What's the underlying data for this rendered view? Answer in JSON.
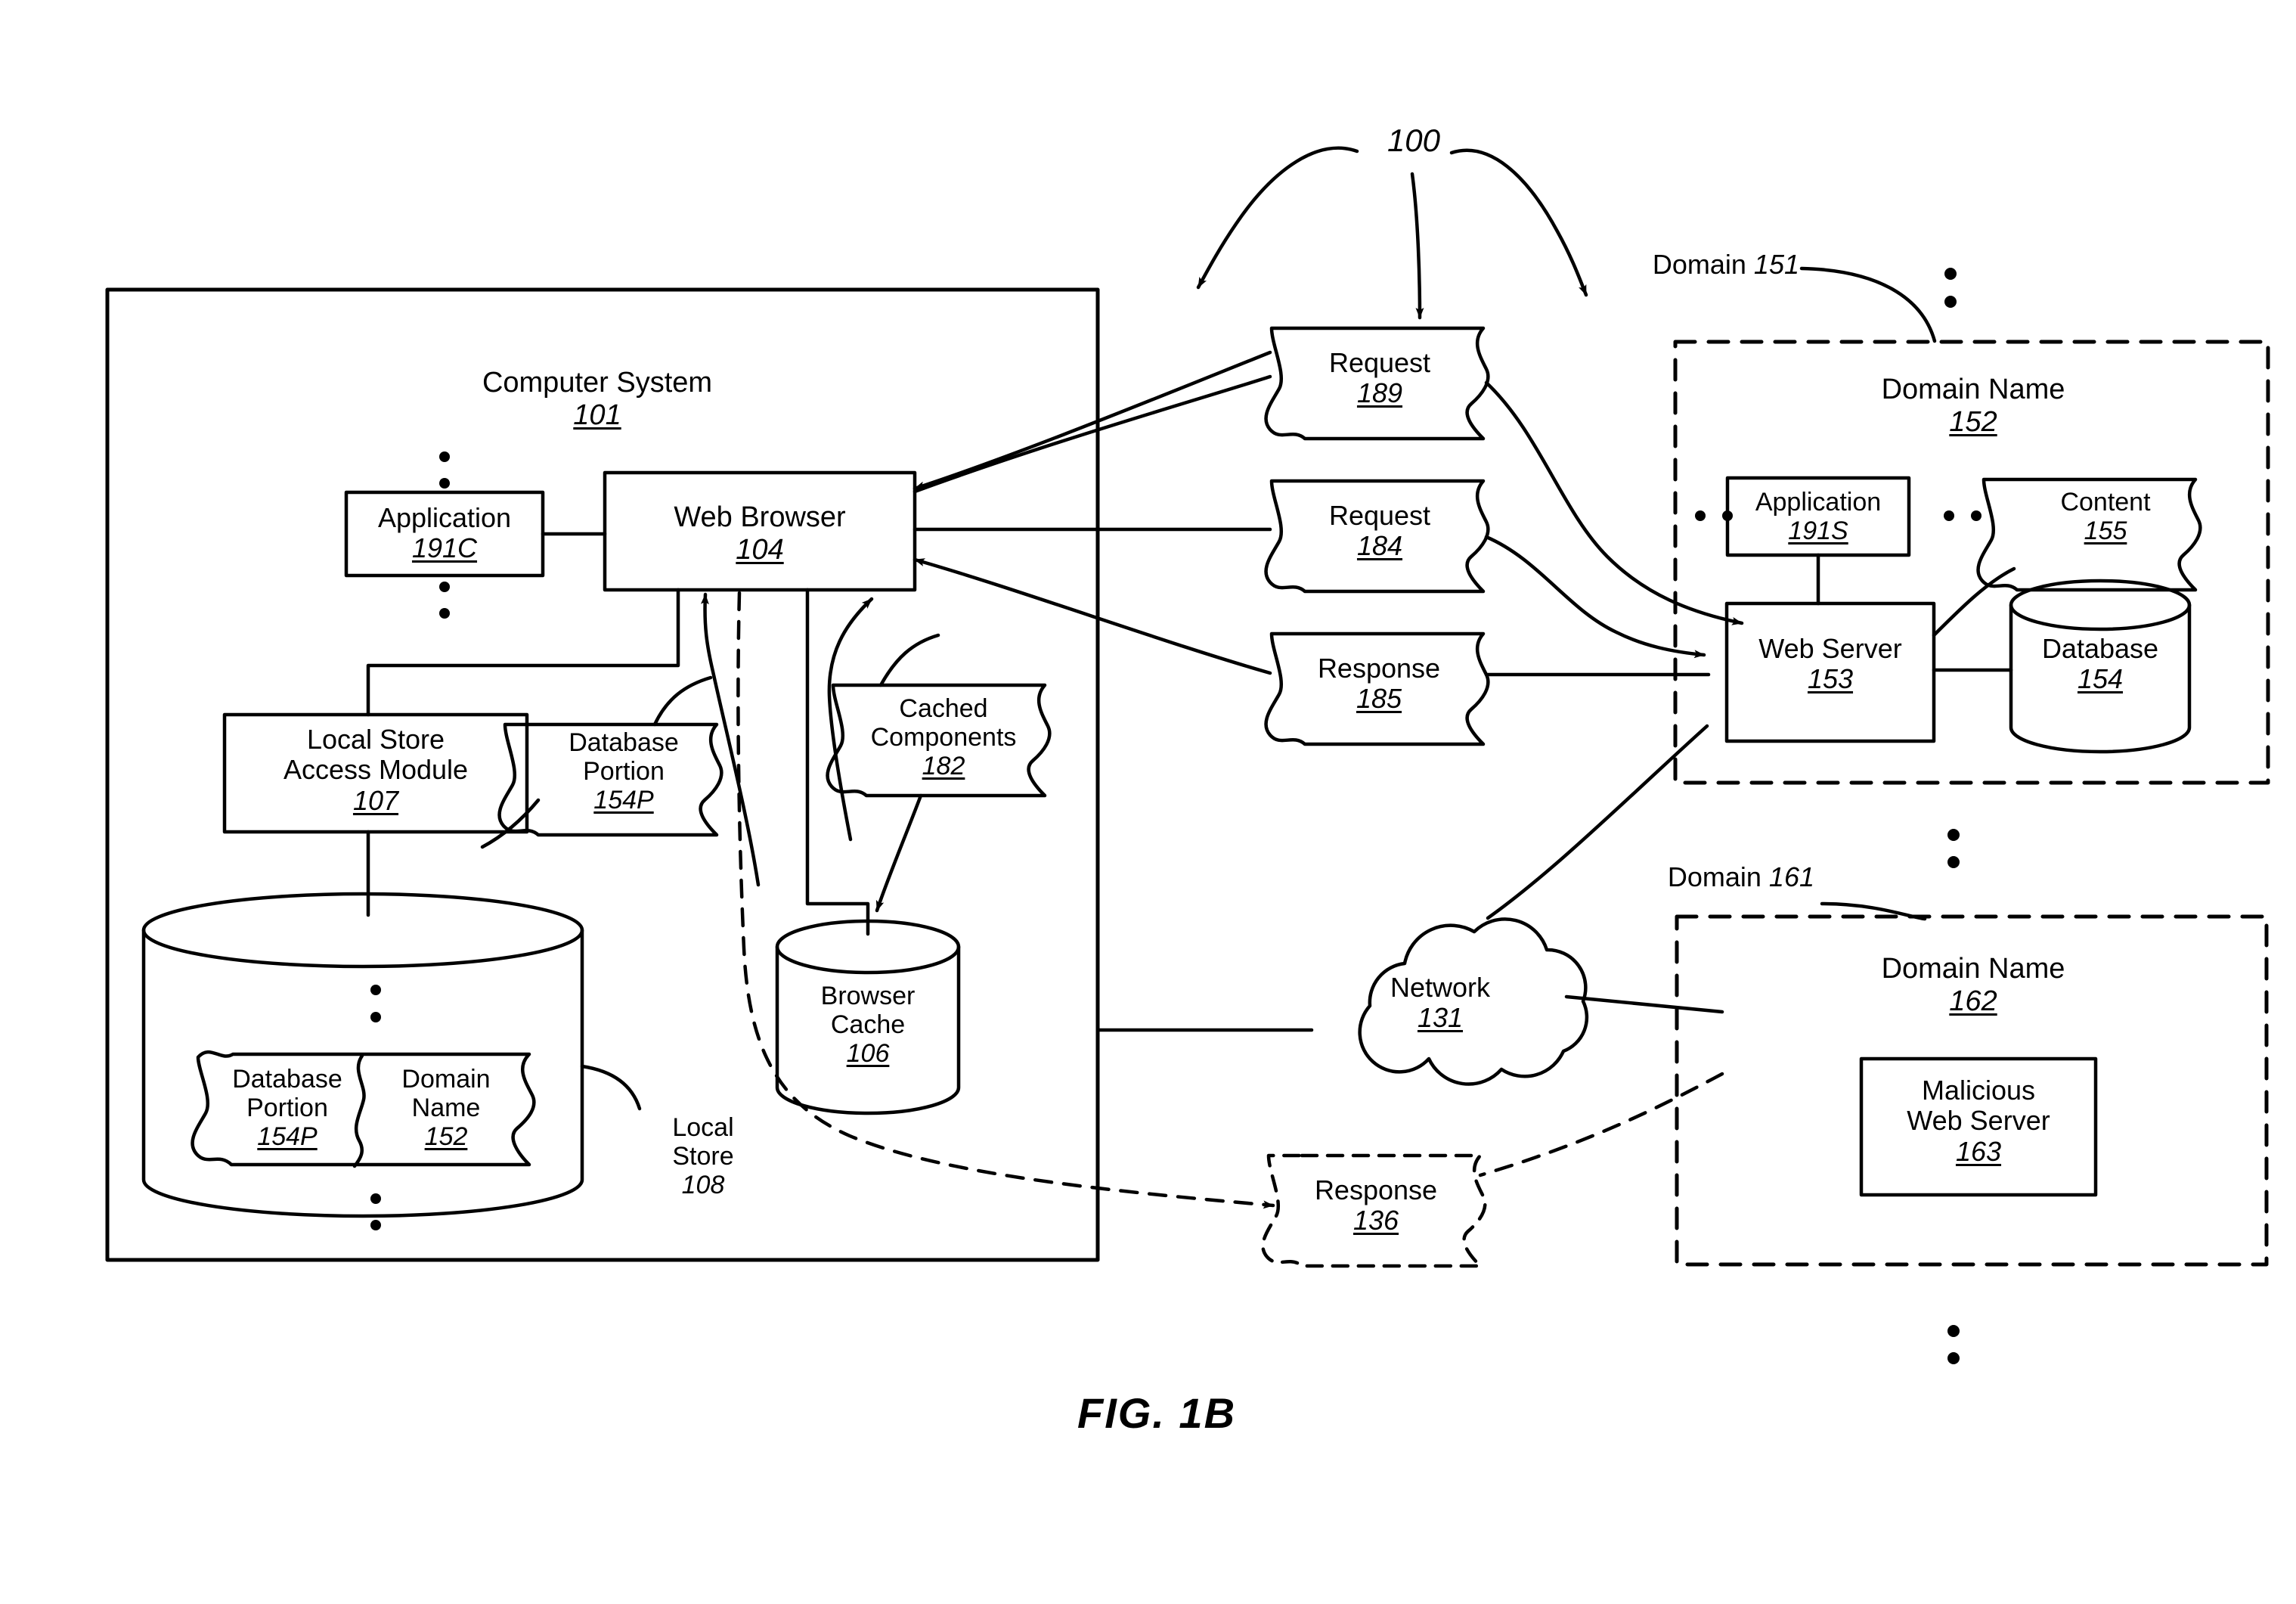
{
  "figure": {
    "caption": "FIG.  1B",
    "system_ref": "100"
  },
  "computer_system": {
    "title": "Computer System",
    "ref": "101",
    "application": {
      "title": "Application",
      "ref": "191C"
    },
    "web_browser": {
      "title": "Web Browser",
      "ref": "104"
    },
    "local_store_access_module": {
      "title": "Local Store",
      "title2": "Access Module",
      "ref": "107"
    },
    "database_portion_doc": {
      "title": "Database",
      "title2": "Portion",
      "ref": "154P"
    },
    "cached_components": {
      "title": "Cached",
      "title2": "Components",
      "ref": "182"
    },
    "browser_cache": {
      "title": "Browser",
      "title2": "Cache",
      "ref": "106"
    },
    "local_store": {
      "title": "Local",
      "title2": "Store",
      "ref": "108"
    },
    "stored_database_portion": {
      "title": "Database",
      "title2": "Portion",
      "ref": "154P"
    },
    "stored_domain_name": {
      "title": "Domain",
      "title2": "Name",
      "ref": "152"
    }
  },
  "messages": [
    {
      "title": "Request",
      "ref": "189",
      "style": "solid"
    },
    {
      "title": "Request",
      "ref": "184",
      "style": "solid"
    },
    {
      "title": "Response",
      "ref": "185",
      "style": "solid"
    },
    {
      "title": "Response",
      "ref": "136",
      "style": "dashed"
    }
  ],
  "network": {
    "title": "Network",
    "ref": "131"
  },
  "domain_151": {
    "callout": "Domain",
    "callout_ref": "151",
    "domain_name": {
      "title": "Domain Name",
      "ref": "152"
    },
    "application": {
      "title": "Application",
      "ref": "191S"
    },
    "content": {
      "title": "Content",
      "ref": "155"
    },
    "web_server": {
      "title": "Web Server",
      "ref": "153"
    },
    "database": {
      "title": "Database",
      "ref": "154"
    }
  },
  "domain_161": {
    "callout": "Domain",
    "callout_ref": "161",
    "domain_name": {
      "title": "Domain Name",
      "ref": "162"
    },
    "malicious_web_server": {
      "title": "Malicious",
      "title2": "Web Server",
      "ref": "163"
    }
  },
  "colors": {
    "ink": "#000000",
    "paper": "#ffffff"
  }
}
